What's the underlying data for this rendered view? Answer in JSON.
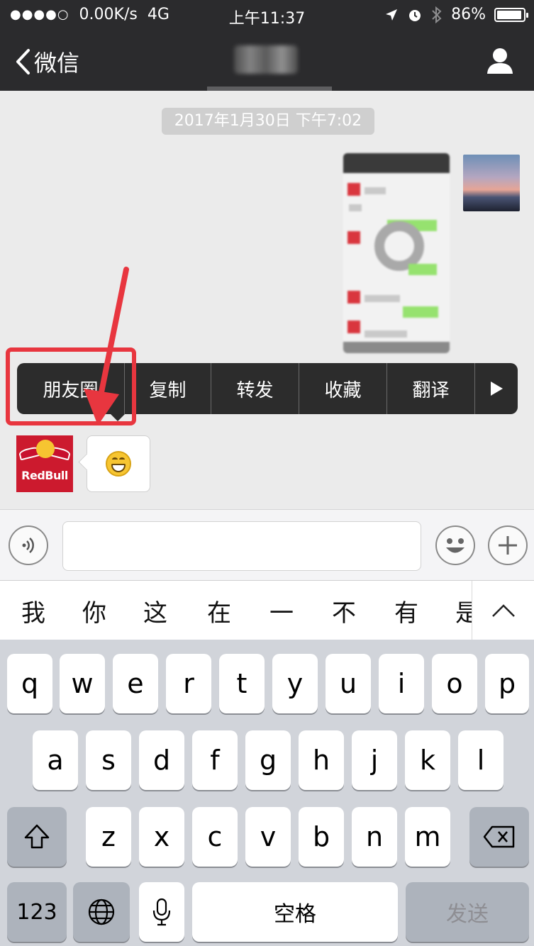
{
  "status_bar": {
    "signal": "●●●●○",
    "speed": "0.00K/s",
    "network": "4G",
    "time": "上午11:37",
    "battery": "86%"
  },
  "nav": {
    "back_label": "微信",
    "title": "大哥"
  },
  "chat": {
    "timestamp": "2017年1月30日 下午7:02",
    "friend_avatar_brand": "RedBull"
  },
  "context_menu": {
    "items": [
      "朋友圈",
      "复制",
      "转发",
      "收藏",
      "翻译"
    ]
  },
  "candidates": [
    "我",
    "你",
    "这",
    "在",
    "一",
    "不",
    "有",
    "是"
  ],
  "keyboard": {
    "row1": [
      "q",
      "w",
      "e",
      "r",
      "t",
      "y",
      "u",
      "i",
      "o",
      "p"
    ],
    "row2": [
      "a",
      "s",
      "d",
      "f",
      "g",
      "h",
      "j",
      "k",
      "l"
    ],
    "row3": [
      "z",
      "x",
      "c",
      "v",
      "b",
      "n",
      "m"
    ],
    "numbers_label": "123",
    "space_label": "空格",
    "send_label": "发送"
  },
  "colors": {
    "nav_bg": "#2b2b2d",
    "chat_bg": "#ebebeb",
    "highlight": "#e8363f",
    "menu_bg": "#2c2c2c",
    "keyboard_bg": "#d1d4da"
  },
  "icons": [
    "back-chevron-icon",
    "profile-icon",
    "location-icon",
    "alarm-icon",
    "bluetooth-icon",
    "battery-icon",
    "voice-icon",
    "emoji-icon",
    "plus-icon",
    "chevron-up-icon",
    "shift-icon",
    "globe-icon",
    "microphone-icon",
    "delete-icon",
    "play-right-icon"
  ]
}
